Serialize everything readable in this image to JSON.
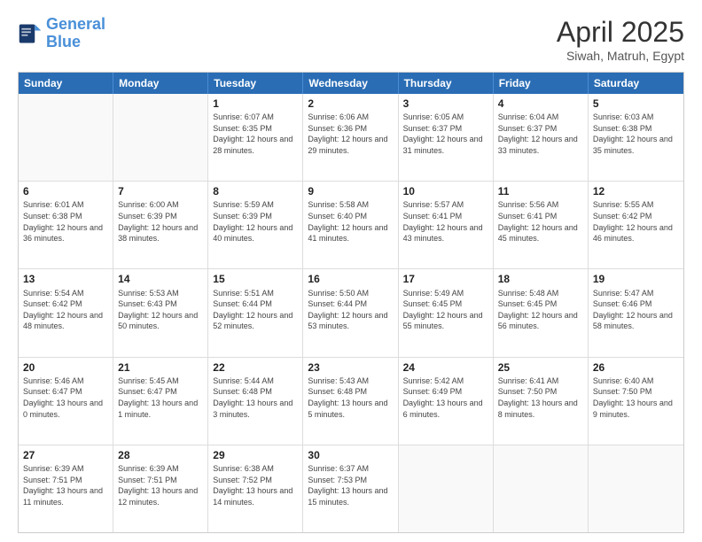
{
  "header": {
    "logo_line1": "General",
    "logo_line2": "Blue",
    "title": "April 2025",
    "subtitle": "Siwah, Matruh, Egypt"
  },
  "calendar": {
    "days_of_week": [
      "Sunday",
      "Monday",
      "Tuesday",
      "Wednesday",
      "Thursday",
      "Friday",
      "Saturday"
    ],
    "rows": [
      [
        {
          "day": "",
          "info": ""
        },
        {
          "day": "",
          "info": ""
        },
        {
          "day": "1",
          "info": "Sunrise: 6:07 AM\nSunset: 6:35 PM\nDaylight: 12 hours and 28 minutes."
        },
        {
          "day": "2",
          "info": "Sunrise: 6:06 AM\nSunset: 6:36 PM\nDaylight: 12 hours and 29 minutes."
        },
        {
          "day": "3",
          "info": "Sunrise: 6:05 AM\nSunset: 6:37 PM\nDaylight: 12 hours and 31 minutes."
        },
        {
          "day": "4",
          "info": "Sunrise: 6:04 AM\nSunset: 6:37 PM\nDaylight: 12 hours and 33 minutes."
        },
        {
          "day": "5",
          "info": "Sunrise: 6:03 AM\nSunset: 6:38 PM\nDaylight: 12 hours and 35 minutes."
        }
      ],
      [
        {
          "day": "6",
          "info": "Sunrise: 6:01 AM\nSunset: 6:38 PM\nDaylight: 12 hours and 36 minutes."
        },
        {
          "day": "7",
          "info": "Sunrise: 6:00 AM\nSunset: 6:39 PM\nDaylight: 12 hours and 38 minutes."
        },
        {
          "day": "8",
          "info": "Sunrise: 5:59 AM\nSunset: 6:39 PM\nDaylight: 12 hours and 40 minutes."
        },
        {
          "day": "9",
          "info": "Sunrise: 5:58 AM\nSunset: 6:40 PM\nDaylight: 12 hours and 41 minutes."
        },
        {
          "day": "10",
          "info": "Sunrise: 5:57 AM\nSunset: 6:41 PM\nDaylight: 12 hours and 43 minutes."
        },
        {
          "day": "11",
          "info": "Sunrise: 5:56 AM\nSunset: 6:41 PM\nDaylight: 12 hours and 45 minutes."
        },
        {
          "day": "12",
          "info": "Sunrise: 5:55 AM\nSunset: 6:42 PM\nDaylight: 12 hours and 46 minutes."
        }
      ],
      [
        {
          "day": "13",
          "info": "Sunrise: 5:54 AM\nSunset: 6:42 PM\nDaylight: 12 hours and 48 minutes."
        },
        {
          "day": "14",
          "info": "Sunrise: 5:53 AM\nSunset: 6:43 PM\nDaylight: 12 hours and 50 minutes."
        },
        {
          "day": "15",
          "info": "Sunrise: 5:51 AM\nSunset: 6:44 PM\nDaylight: 12 hours and 52 minutes."
        },
        {
          "day": "16",
          "info": "Sunrise: 5:50 AM\nSunset: 6:44 PM\nDaylight: 12 hours and 53 minutes."
        },
        {
          "day": "17",
          "info": "Sunrise: 5:49 AM\nSunset: 6:45 PM\nDaylight: 12 hours and 55 minutes."
        },
        {
          "day": "18",
          "info": "Sunrise: 5:48 AM\nSunset: 6:45 PM\nDaylight: 12 hours and 56 minutes."
        },
        {
          "day": "19",
          "info": "Sunrise: 5:47 AM\nSunset: 6:46 PM\nDaylight: 12 hours and 58 minutes."
        }
      ],
      [
        {
          "day": "20",
          "info": "Sunrise: 5:46 AM\nSunset: 6:47 PM\nDaylight: 13 hours and 0 minutes."
        },
        {
          "day": "21",
          "info": "Sunrise: 5:45 AM\nSunset: 6:47 PM\nDaylight: 13 hours and 1 minute."
        },
        {
          "day": "22",
          "info": "Sunrise: 5:44 AM\nSunset: 6:48 PM\nDaylight: 13 hours and 3 minutes."
        },
        {
          "day": "23",
          "info": "Sunrise: 5:43 AM\nSunset: 6:48 PM\nDaylight: 13 hours and 5 minutes."
        },
        {
          "day": "24",
          "info": "Sunrise: 5:42 AM\nSunset: 6:49 PM\nDaylight: 13 hours and 6 minutes."
        },
        {
          "day": "25",
          "info": "Sunrise: 6:41 AM\nSunset: 7:50 PM\nDaylight: 13 hours and 8 minutes."
        },
        {
          "day": "26",
          "info": "Sunrise: 6:40 AM\nSunset: 7:50 PM\nDaylight: 13 hours and 9 minutes."
        }
      ],
      [
        {
          "day": "27",
          "info": "Sunrise: 6:39 AM\nSunset: 7:51 PM\nDaylight: 13 hours and 11 minutes."
        },
        {
          "day": "28",
          "info": "Sunrise: 6:39 AM\nSunset: 7:51 PM\nDaylight: 13 hours and 12 minutes."
        },
        {
          "day": "29",
          "info": "Sunrise: 6:38 AM\nSunset: 7:52 PM\nDaylight: 13 hours and 14 minutes."
        },
        {
          "day": "30",
          "info": "Sunrise: 6:37 AM\nSunset: 7:53 PM\nDaylight: 13 hours and 15 minutes."
        },
        {
          "day": "",
          "info": ""
        },
        {
          "day": "",
          "info": ""
        },
        {
          "day": "",
          "info": ""
        }
      ]
    ]
  }
}
